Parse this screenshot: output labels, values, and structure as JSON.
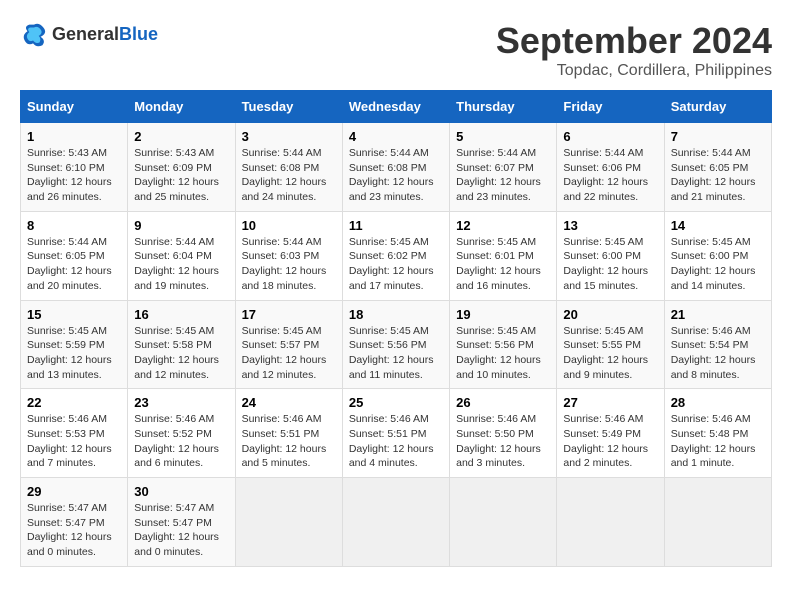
{
  "header": {
    "logo_general": "General",
    "logo_blue": "Blue",
    "month": "September 2024",
    "location": "Topdac, Cordillera, Philippines"
  },
  "columns": [
    "Sunday",
    "Monday",
    "Tuesday",
    "Wednesday",
    "Thursday",
    "Friday",
    "Saturday"
  ],
  "rows": [
    [
      {
        "day": "",
        "detail": ""
      },
      {
        "day": "2",
        "detail": "Sunrise: 5:43 AM\nSunset: 6:09 PM\nDaylight: 12 hours and 25 minutes."
      },
      {
        "day": "3",
        "detail": "Sunrise: 5:44 AM\nSunset: 6:08 PM\nDaylight: 12 hours and 24 minutes."
      },
      {
        "day": "4",
        "detail": "Sunrise: 5:44 AM\nSunset: 6:08 PM\nDaylight: 12 hours and 23 minutes."
      },
      {
        "day": "5",
        "detail": "Sunrise: 5:44 AM\nSunset: 6:07 PM\nDaylight: 12 hours and 23 minutes."
      },
      {
        "day": "6",
        "detail": "Sunrise: 5:44 AM\nSunset: 6:06 PM\nDaylight: 12 hours and 22 minutes."
      },
      {
        "day": "7",
        "detail": "Sunrise: 5:44 AM\nSunset: 6:05 PM\nDaylight: 12 hours and 21 minutes."
      }
    ],
    [
      {
        "day": "8",
        "detail": "Sunrise: 5:44 AM\nSunset: 6:05 PM\nDaylight: 12 hours and 20 minutes."
      },
      {
        "day": "9",
        "detail": "Sunrise: 5:44 AM\nSunset: 6:04 PM\nDaylight: 12 hours and 19 minutes."
      },
      {
        "day": "10",
        "detail": "Sunrise: 5:44 AM\nSunset: 6:03 PM\nDaylight: 12 hours and 18 minutes."
      },
      {
        "day": "11",
        "detail": "Sunrise: 5:45 AM\nSunset: 6:02 PM\nDaylight: 12 hours and 17 minutes."
      },
      {
        "day": "12",
        "detail": "Sunrise: 5:45 AM\nSunset: 6:01 PM\nDaylight: 12 hours and 16 minutes."
      },
      {
        "day": "13",
        "detail": "Sunrise: 5:45 AM\nSunset: 6:00 PM\nDaylight: 12 hours and 15 minutes."
      },
      {
        "day": "14",
        "detail": "Sunrise: 5:45 AM\nSunset: 6:00 PM\nDaylight: 12 hours and 14 minutes."
      }
    ],
    [
      {
        "day": "15",
        "detail": "Sunrise: 5:45 AM\nSunset: 5:59 PM\nDaylight: 12 hours and 13 minutes."
      },
      {
        "day": "16",
        "detail": "Sunrise: 5:45 AM\nSunset: 5:58 PM\nDaylight: 12 hours and 12 minutes."
      },
      {
        "day": "17",
        "detail": "Sunrise: 5:45 AM\nSunset: 5:57 PM\nDaylight: 12 hours and 12 minutes."
      },
      {
        "day": "18",
        "detail": "Sunrise: 5:45 AM\nSunset: 5:56 PM\nDaylight: 12 hours and 11 minutes."
      },
      {
        "day": "19",
        "detail": "Sunrise: 5:45 AM\nSunset: 5:56 PM\nDaylight: 12 hours and 10 minutes."
      },
      {
        "day": "20",
        "detail": "Sunrise: 5:45 AM\nSunset: 5:55 PM\nDaylight: 12 hours and 9 minutes."
      },
      {
        "day": "21",
        "detail": "Sunrise: 5:46 AM\nSunset: 5:54 PM\nDaylight: 12 hours and 8 minutes."
      }
    ],
    [
      {
        "day": "22",
        "detail": "Sunrise: 5:46 AM\nSunset: 5:53 PM\nDaylight: 12 hours and 7 minutes."
      },
      {
        "day": "23",
        "detail": "Sunrise: 5:46 AM\nSunset: 5:52 PM\nDaylight: 12 hours and 6 minutes."
      },
      {
        "day": "24",
        "detail": "Sunrise: 5:46 AM\nSunset: 5:51 PM\nDaylight: 12 hours and 5 minutes."
      },
      {
        "day": "25",
        "detail": "Sunrise: 5:46 AM\nSunset: 5:51 PM\nDaylight: 12 hours and 4 minutes."
      },
      {
        "day": "26",
        "detail": "Sunrise: 5:46 AM\nSunset: 5:50 PM\nDaylight: 12 hours and 3 minutes."
      },
      {
        "day": "27",
        "detail": "Sunrise: 5:46 AM\nSunset: 5:49 PM\nDaylight: 12 hours and 2 minutes."
      },
      {
        "day": "28",
        "detail": "Sunrise: 5:46 AM\nSunset: 5:48 PM\nDaylight: 12 hours and 1 minute."
      }
    ],
    [
      {
        "day": "29",
        "detail": "Sunrise: 5:47 AM\nSunset: 5:47 PM\nDaylight: 12 hours and 0 minutes."
      },
      {
        "day": "30",
        "detail": "Sunrise: 5:47 AM\nSunset: 5:47 PM\nDaylight: 12 hours and 0 minutes."
      },
      {
        "day": "",
        "detail": ""
      },
      {
        "day": "",
        "detail": ""
      },
      {
        "day": "",
        "detail": ""
      },
      {
        "day": "",
        "detail": ""
      },
      {
        "day": "",
        "detail": ""
      }
    ]
  ],
  "row0_col0": {
    "day": "1",
    "detail": "Sunrise: 5:43 AM\nSunset: 6:10 PM\nDaylight: 12 hours and 26 minutes."
  }
}
